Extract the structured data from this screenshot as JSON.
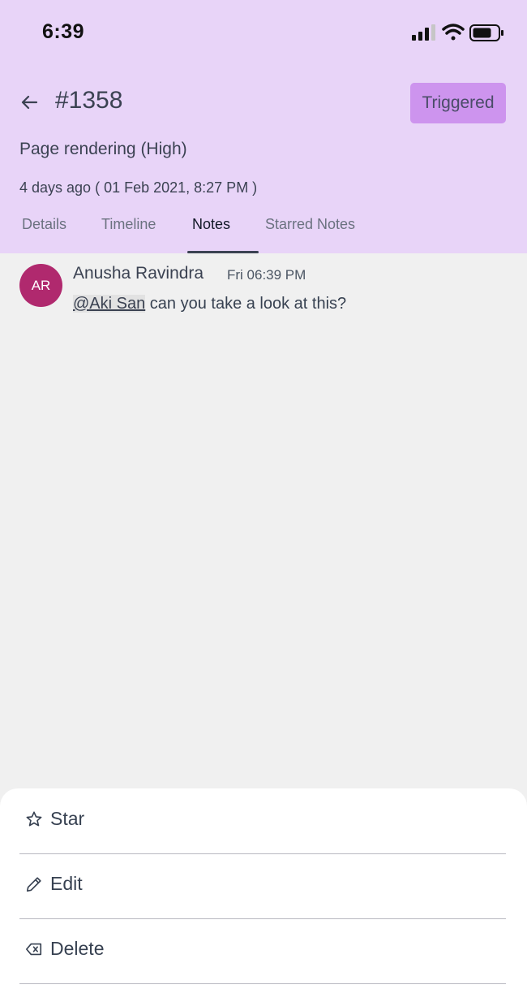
{
  "status_bar": {
    "time": "6:39"
  },
  "header": {
    "incident_id": "#1358",
    "status_button": "Triggered",
    "title": "Page rendering (High)",
    "time_info": "4 days ago ( 01 Feb 2021, 8:27 PM )"
  },
  "tabs": [
    {
      "label": "Details",
      "active": false
    },
    {
      "label": "Timeline",
      "active": false
    },
    {
      "label": "Notes",
      "active": true
    },
    {
      "label": "Starred Notes",
      "active": false
    }
  ],
  "notes": [
    {
      "avatar_initials": "AR",
      "avatar_color": "#b0296e",
      "author": "Anusha Ravindra",
      "timestamp": "Fri 06:39 PM",
      "mention": "@Aki San",
      "text": " can you take a look at this?"
    }
  ],
  "action_sheet": {
    "items": [
      {
        "label": "Star",
        "icon": "star-icon"
      },
      {
        "label": "Edit",
        "icon": "pencil-icon"
      },
      {
        "label": "Delete",
        "icon": "backspace-icon"
      }
    ]
  },
  "colors": {
    "header_bg": "#e8d4f8",
    "status_button_bg": "#cd94ee",
    "content_bg": "#f0f0f0"
  }
}
